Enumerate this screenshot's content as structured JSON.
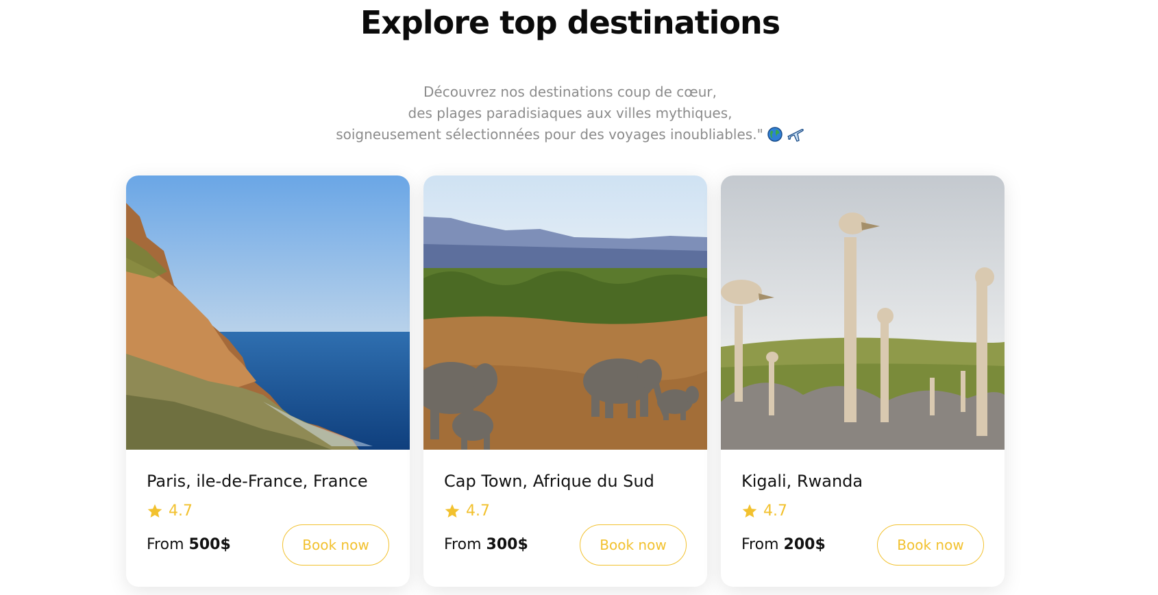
{
  "header": {
    "title": "Explore top destinations",
    "subtitle_lines": [
      "Découvrez nos destinations coup de cœur,",
      "des plages paradisiaques aux villes mythiques,",
      "soigneusement sélectionnées pour des voyages inoubliables.\""
    ],
    "subtitle_icons": [
      "globe-icon",
      "airplane-icon"
    ]
  },
  "colors": {
    "accent": "#f2c12e",
    "text": "#111111",
    "muted": "#8b8b8b"
  },
  "destinations": [
    {
      "name": "Paris, ile-de-France, France",
      "rating": "4.7",
      "price_prefix": "From",
      "price": "500$",
      "button_label": "Book now",
      "image": "coastal-cliff-ocean"
    },
    {
      "name": "Cap Town, Afrique du Sud",
      "rating": "4.7",
      "price_prefix": "From",
      "price": "300$",
      "button_label": "Book now",
      "image": "elephants-savanna"
    },
    {
      "name": "Kigali, Rwanda",
      "rating": "4.7",
      "price_prefix": "From",
      "price": "200$",
      "button_label": "Book now",
      "image": "ostriches-field"
    }
  ]
}
